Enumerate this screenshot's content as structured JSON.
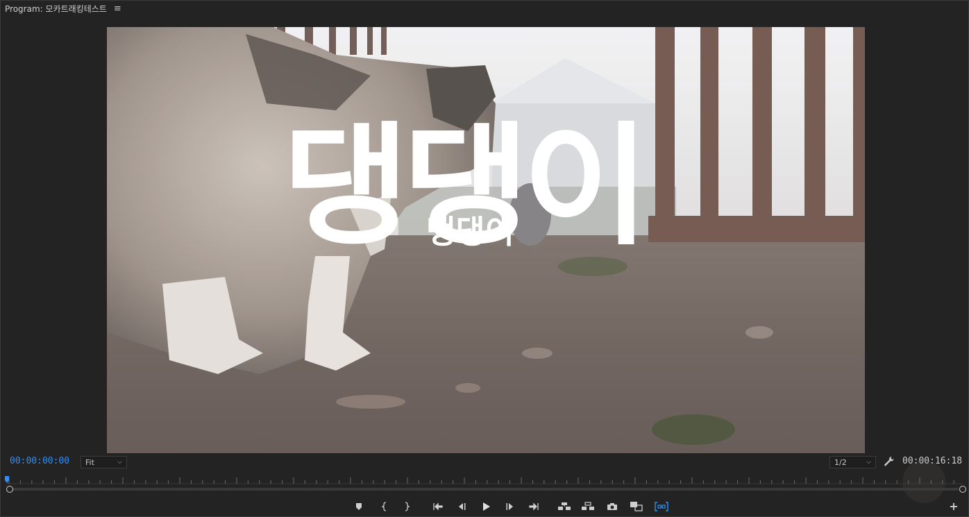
{
  "panel": {
    "title": "Program: 모카트래킹테스트",
    "menu_icon": "hamburger-icon",
    "menu_glyph": "≡"
  },
  "video": {
    "caption_main": "댕댕이",
    "caption_sub": "댕댕이"
  },
  "controls": {
    "current_timecode": "00:00:00:00",
    "zoom_label": "Fit",
    "resolution_label": "1/2",
    "duration_timecode": "00:00:16:18",
    "playhead_position": 0.0
  },
  "transport": [
    {
      "name": "add-marker-button",
      "icon": "marker-icon"
    },
    {
      "name": "mark-in-button",
      "icon": "mark-in-icon"
    },
    {
      "name": "mark-out-button",
      "icon": "mark-out-icon"
    },
    {
      "name": "go-to-in-button",
      "icon": "go-to-in-icon"
    },
    {
      "name": "step-back-button",
      "icon": "step-back-icon"
    },
    {
      "name": "play-button",
      "icon": "play-icon"
    },
    {
      "name": "step-forward-button",
      "icon": "step-forward-icon"
    },
    {
      "name": "go-to-out-button",
      "icon": "go-to-out-icon"
    },
    {
      "name": "lift-button",
      "icon": "lift-icon"
    },
    {
      "name": "extract-button",
      "icon": "extract-icon"
    },
    {
      "name": "export-frame-button",
      "icon": "camera-icon"
    },
    {
      "name": "comparison-view-button",
      "icon": "comparison-icon"
    },
    {
      "name": "proxy-toggle-button",
      "icon": "proxy-icon"
    }
  ],
  "colors": {
    "accent": "#2f8ff5",
    "panel_bg": "#232323"
  }
}
